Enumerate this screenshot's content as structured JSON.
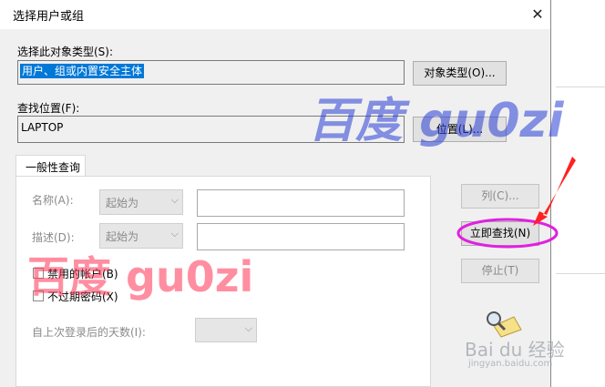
{
  "dialog": {
    "title": "选择用户或组",
    "object_type_label": "选择此对象类型(S):",
    "object_type_value": "用户、组或内置安全主体",
    "object_type_button": "对象类型(O)...",
    "location_label": "查找位置(F):",
    "location_value": "LAPTOP",
    "location_button": "位置(L)...",
    "tab_label": "一般性查询",
    "name_label": "名称(A):",
    "name_mode": "起始为",
    "desc_label": "描述(D):",
    "desc_mode": "起始为",
    "disabled_accounts": "禁用的帐户(B)",
    "non_expiring_pw": "不过期密码(X)",
    "days_since_logon_label": "自上次登录后的天数(I):",
    "columns_button": "列(C)...",
    "find_now_button": "立即查找(N)",
    "stop_button": "停止(T)"
  },
  "watermarks": {
    "blue": "百度 gu0zi",
    "red": "百度 gu0zi",
    "baidu": "Bai du 经验",
    "baidu_sub": "jingyan.baidu.com"
  },
  "colors": {
    "selection": "#0078d7",
    "highlight_ellipse": "#e020e0",
    "arrow": "#ff2020"
  },
  "icons": [
    "close-icon",
    "chevron-down-icon",
    "search-magnifier-icon"
  ]
}
